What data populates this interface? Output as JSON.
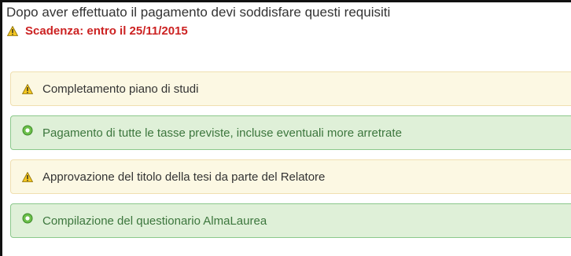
{
  "heading": "Dopo aver effettuato il pagamento devi soddisfare questi requisiti",
  "deadline": {
    "icon": "warning-icon",
    "text": "Scadenza: entro il 25/11/2015"
  },
  "requirements": [
    {
      "status": "pending",
      "icon": "warning-icon",
      "label": "Completamento piano di studi"
    },
    {
      "status": "done",
      "icon": "check-circle-icon",
      "label": "Pagamento di tutte le tasse previste, incluse eventuali more arretrate"
    },
    {
      "status": "pending",
      "icon": "warning-icon",
      "label": "Approvazione del titolo della tesi da parte del Relatore"
    },
    {
      "status": "done",
      "icon": "check-circle-icon",
      "label": "Compilazione del questionario AlmaLaurea"
    }
  ],
  "colors": {
    "deadline_text": "#cc2222",
    "pending_bg": "#fcf8e3",
    "done_bg": "#dff0d8",
    "done_text": "#3c763d"
  }
}
